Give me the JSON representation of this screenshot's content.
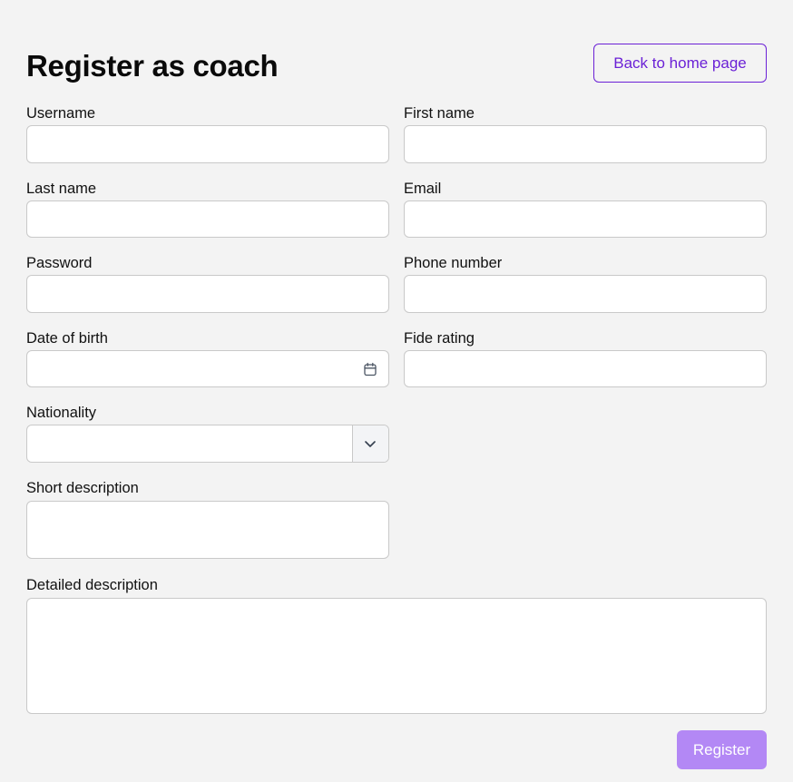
{
  "page": {
    "title": "Register as coach",
    "back_button_label": "Back to home page"
  },
  "form": {
    "username": {
      "label": "Username",
      "value": ""
    },
    "first_name": {
      "label": "First name",
      "value": ""
    },
    "last_name": {
      "label": "Last name",
      "value": ""
    },
    "email": {
      "label": "Email",
      "value": ""
    },
    "password": {
      "label": "Password",
      "value": ""
    },
    "phone_number": {
      "label": "Phone number",
      "value": ""
    },
    "date_of_birth": {
      "label": "Date of birth",
      "value": "",
      "icon": "calendar-icon"
    },
    "fide_rating": {
      "label": "Fide rating",
      "value": ""
    },
    "nationality": {
      "label": "Nationality",
      "selected": "",
      "icon": "chevron-down-icon"
    },
    "short_description": {
      "label": "Short description",
      "value": ""
    },
    "detailed_description": {
      "label": "Detailed description",
      "value": ""
    },
    "submit_label": "Register"
  },
  "colors": {
    "background": "#f3f3f3",
    "accent": "#6b21d6",
    "register_button": "#b388f5",
    "field_border": "#c9c9c9"
  }
}
